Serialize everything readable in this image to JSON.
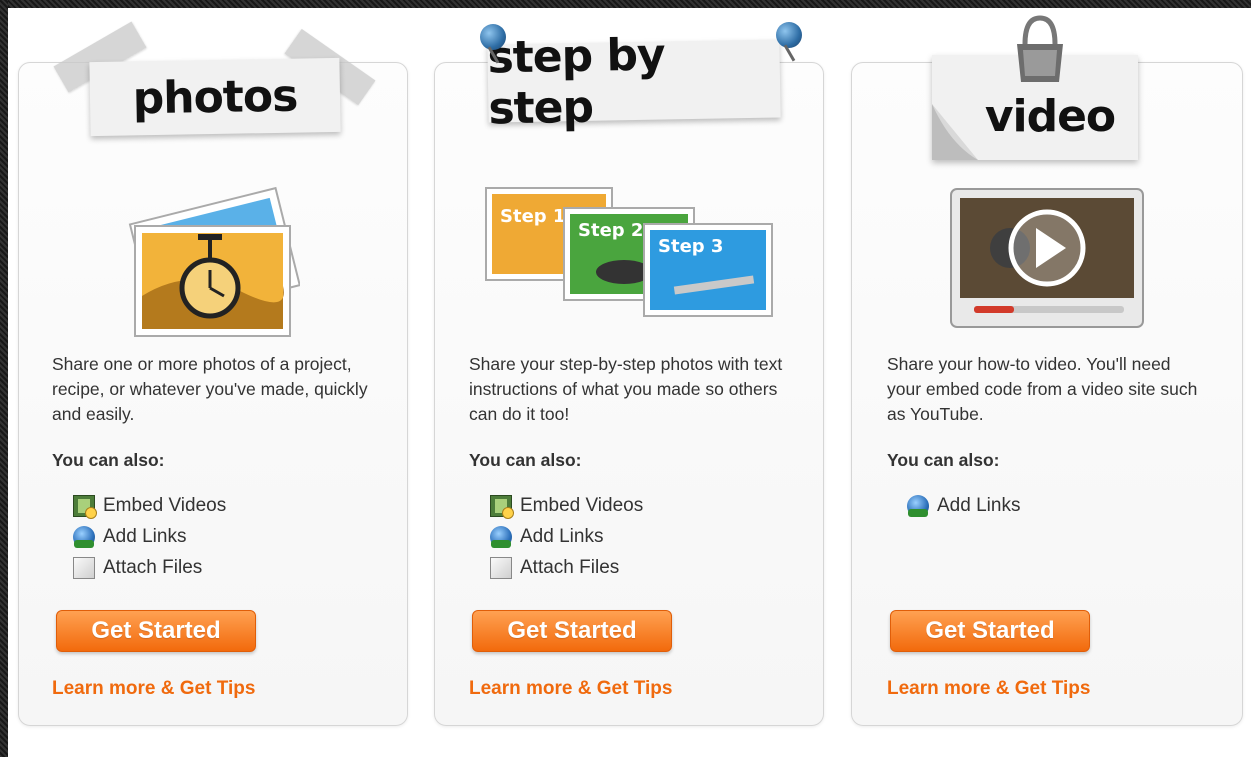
{
  "cards": [
    {
      "tag": "photos",
      "description": "Share one or more photos of a project, recipe, or whatever you've made, quickly and easily.",
      "also_heading": "You can also:",
      "features": [
        {
          "icon": "film-icon",
          "label": "Embed Videos"
        },
        {
          "icon": "globe-link-icon",
          "label": "Add Links"
        },
        {
          "icon": "file-icon",
          "label": "Attach Files"
        }
      ],
      "button_label": "Get Started",
      "learn_more": "Learn more & Get Tips"
    },
    {
      "tag": "step by step",
      "description": "Share your step-by-step photos with text instructions of what you made so others can do it too!",
      "also_heading": "You can also:",
      "features": [
        {
          "icon": "film-icon",
          "label": "Embed Videos"
        },
        {
          "icon": "globe-link-icon",
          "label": "Add Links"
        },
        {
          "icon": "file-icon",
          "label": "Attach Files"
        }
      ],
      "step_labels": [
        "Step 1",
        "Step 2",
        "Step 3"
      ],
      "button_label": "Get Started",
      "learn_more": "Learn more & Get Tips"
    },
    {
      "tag": "video",
      "description": "Share your how-to video. You'll need your embed code from a video site such as YouTube.",
      "also_heading": "You can also:",
      "features": [
        {
          "icon": "globe-link-icon",
          "label": "Add Links"
        }
      ],
      "button_label": "Get Started",
      "learn_more": "Learn more & Get Tips"
    }
  ],
  "colors": {
    "accent": "#f26a0c",
    "link": "#f06a0e",
    "text": "#333333"
  }
}
